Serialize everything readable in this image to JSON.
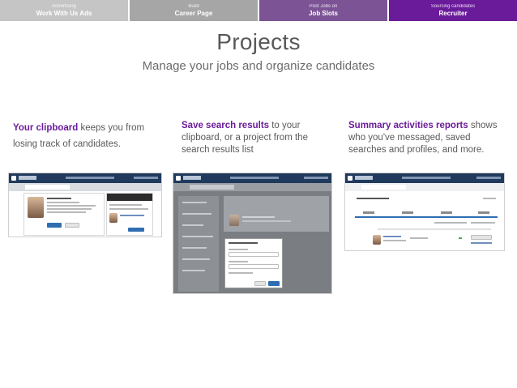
{
  "tabs": [
    {
      "sub": "Advertising",
      "main": "Work With Us Ads"
    },
    {
      "sub": "Build",
      "main": "Career Page"
    },
    {
      "sub": "Post Jobs on",
      "main": "Job Slots"
    },
    {
      "sub": "Sourcing candidates",
      "main": "Recruiter"
    }
  ],
  "header": {
    "title": "Projects",
    "subtitle": "Manage your jobs and organize candidates"
  },
  "columns": [
    {
      "highlight": "Your clipboard",
      "text": " keeps you from losing track of candidates."
    },
    {
      "highlight": "Save search results",
      "text": " to your clipboard, or a project from the search results list"
    },
    {
      "highlight": "Summary activities reports",
      "text": " shows who you've messaged, saved searches and profiles, and more."
    }
  ],
  "colors": {
    "accent": "#6a1b9a",
    "tab_light": "#c5c5c5",
    "tab_mid": "#a6a6a6",
    "tab_purple": "#7c5496",
    "nav_bar": "#1f3a5c"
  }
}
